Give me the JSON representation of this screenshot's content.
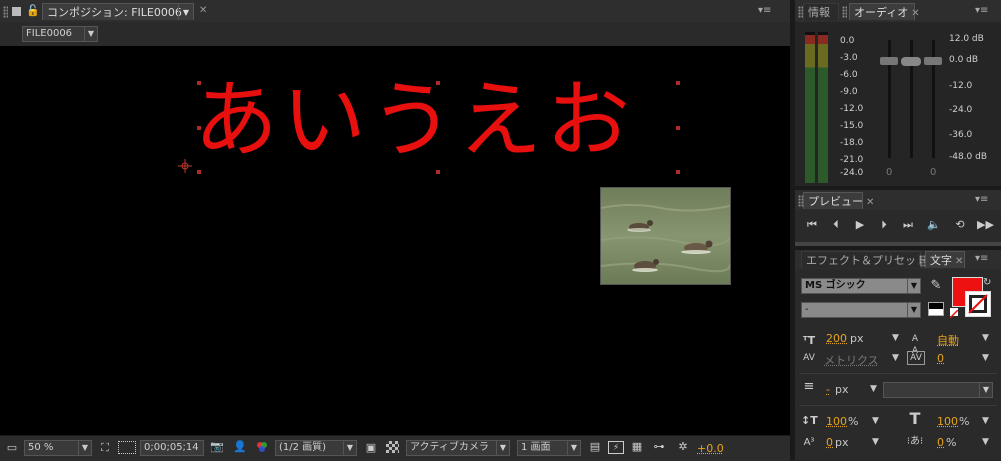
{
  "composition": {
    "tab_label": "コンポジション: FILE0006",
    "comp_selector": "FILE0006",
    "text_layer": "あいうえお",
    "text_color": "#e80f0f"
  },
  "bottom_bar": {
    "zoom": "50 %",
    "timecode": "0;00;05;14",
    "resolution": "(1/2 画質)",
    "camera": "アクティブカメラ",
    "views": "1 画面",
    "exposure": "+0.0"
  },
  "info_panel": {
    "tab_info": "情報",
    "tab_audio": "オーディオ",
    "db_scale_left": [
      "0.0",
      "-3.0",
      "-6.0",
      "-9.0",
      "-12.0",
      "-15.0",
      "-18.0",
      "-21.0",
      "-24.0"
    ],
    "db_scale_right": [
      "12.0 dB",
      "0.0 dB",
      "-12.0",
      "-24.0",
      "-36.0",
      "-48.0 dB"
    ],
    "slider_values": [
      "0",
      "0"
    ]
  },
  "preview_panel": {
    "tab_label": "プレビュー"
  },
  "character_panel": {
    "tab_effects": "エフェクト＆プリセット",
    "tab_character": "文字",
    "font_family": "MS ゴシック",
    "font_style": "-",
    "fill_color": "#ee1111",
    "font_size": "200",
    "font_size_unit": "px",
    "leading": "自動",
    "kerning": "メトリクス",
    "tracking": "0",
    "stroke_width": "-",
    "stroke_unit": "px",
    "vertical_scale": "100",
    "horizontal_scale": "100",
    "percent_symbol": "%",
    "baseline_shift": "0",
    "baseline_unit": "px",
    "tsume": "0",
    "tsume_unit": "%"
  }
}
